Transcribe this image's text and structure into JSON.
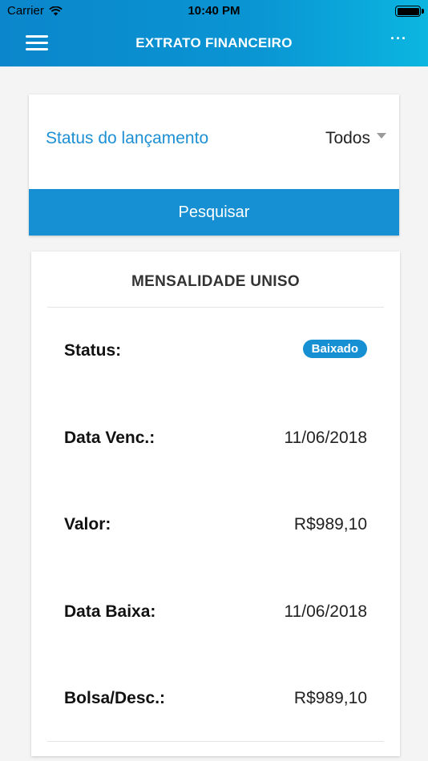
{
  "status_bar": {
    "carrier": "Carrier",
    "time": "10:40 PM"
  },
  "nav": {
    "title": "EXTRATO FINANCEIRO",
    "menu_icon": "hamburger-menu-icon",
    "more_icon": "more-options-icon",
    "more_glyph": "···"
  },
  "filter": {
    "label": "Status do lançamento",
    "selected": "Todos",
    "search_label": "Pesquisar"
  },
  "card": {
    "title": "MENSALIDADE UNISO",
    "rows": [
      {
        "label": "Status:",
        "value": "Baixado"
      },
      {
        "label": "Data Venc.:",
        "value": "11/06/2018"
      },
      {
        "label": "Valor:",
        "value": "R$989,10"
      },
      {
        "label": "Data Baixa:",
        "value": "11/06/2018"
      },
      {
        "label": "Bolsa/Desc.:",
        "value": "R$989,10"
      }
    ]
  },
  "colors": {
    "accent": "#1690d2",
    "header_start": "#0b86cc",
    "header_end": "#0bb6e0"
  }
}
